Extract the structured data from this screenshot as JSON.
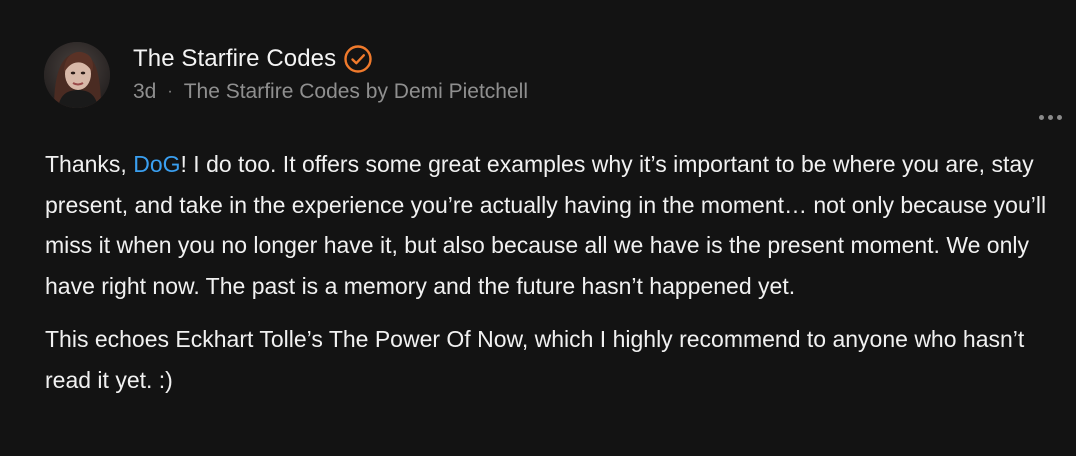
{
  "post": {
    "author_name": "The Starfire Codes",
    "verified_icon": "verified-check-icon",
    "timestamp": "3d",
    "separator": "·",
    "publication": "The Starfire Codes by Demi Pietchell",
    "more_icon": "more-options-icon",
    "accent_color": "#f07a2c",
    "mention_color": "#3a9ff0",
    "paragraph1": {
      "before_mention": "Thanks, ",
      "mention": "DoG",
      "after_mention": "! I do too. It offers some great examples why it’s important to be where you are, stay present, and take in the experience you’re actually having in the moment… not only because you’ll miss it when you no longer have it, but also because all we have is the present moment. We only have right now. The past is a memory and the future hasn’t happened yet."
    },
    "paragraph2": "This echoes Eckhart Tolle’s The Power Of Now, which I highly recommend to anyone who hasn’t read it yet. :)"
  }
}
